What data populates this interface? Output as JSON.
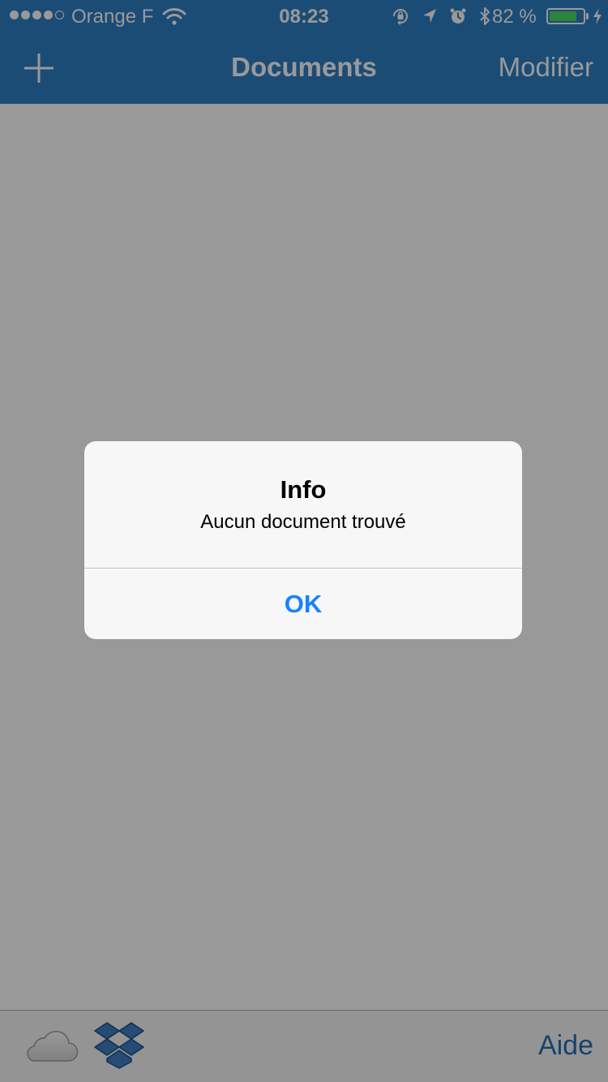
{
  "status_bar": {
    "carrier": "Orange F",
    "time": "08:23",
    "battery_percent": "82 %",
    "battery_level": 0.82,
    "signal_bars_filled": 4,
    "signal_bars_total": 5,
    "icons": [
      "wifi-icon",
      "rotation-lock-icon",
      "location-icon",
      "alarm-icon",
      "bluetooth-icon",
      "battery-icon",
      "charging-icon"
    ]
  },
  "navbar": {
    "title": "Documents",
    "add_icon": "plus-icon",
    "edit_label": "Modifier"
  },
  "toolbar": {
    "cloud_icon": "icloud-icon",
    "dropbox_icon": "dropbox-icon",
    "help_label": "Aide"
  },
  "alert": {
    "title": "Info",
    "message": "Aucun document trouvé",
    "ok_label": "OK"
  },
  "colors": {
    "nav_bar": "#2d7fc5",
    "accent": "#1a82fb",
    "toolbar_link": "#2370b8",
    "battery_fill": "#4cd964",
    "overlay": "rgba(0,0,0,0.4)"
  }
}
